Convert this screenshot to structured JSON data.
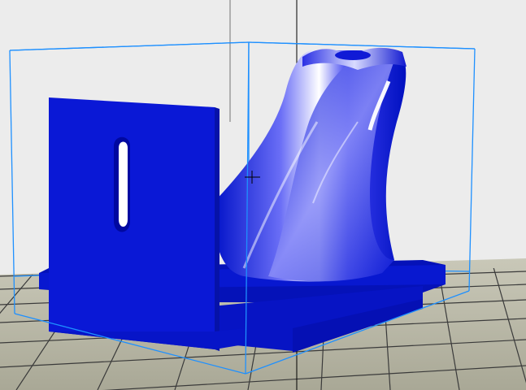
{
  "viewport": {
    "background_color": "#ececec",
    "view": "3d-perspective",
    "model_name": "",
    "status_text": ""
  },
  "colors": {
    "floor_grid_light": "#b9b8a7",
    "floor_grid_dark": "#3a3a3a",
    "model_blue": "#0a18d6",
    "model_blue_shadow": "#0612b0",
    "highlight_white": "#ffffff",
    "bounding_box_cyan": "#1e90ff",
    "axis_line": "#000000"
  },
  "icons": {
    "crosshair": "crosshair-icon",
    "model": "bracket-model-icon"
  },
  "selection": {
    "bounding_box_visible": true
  }
}
